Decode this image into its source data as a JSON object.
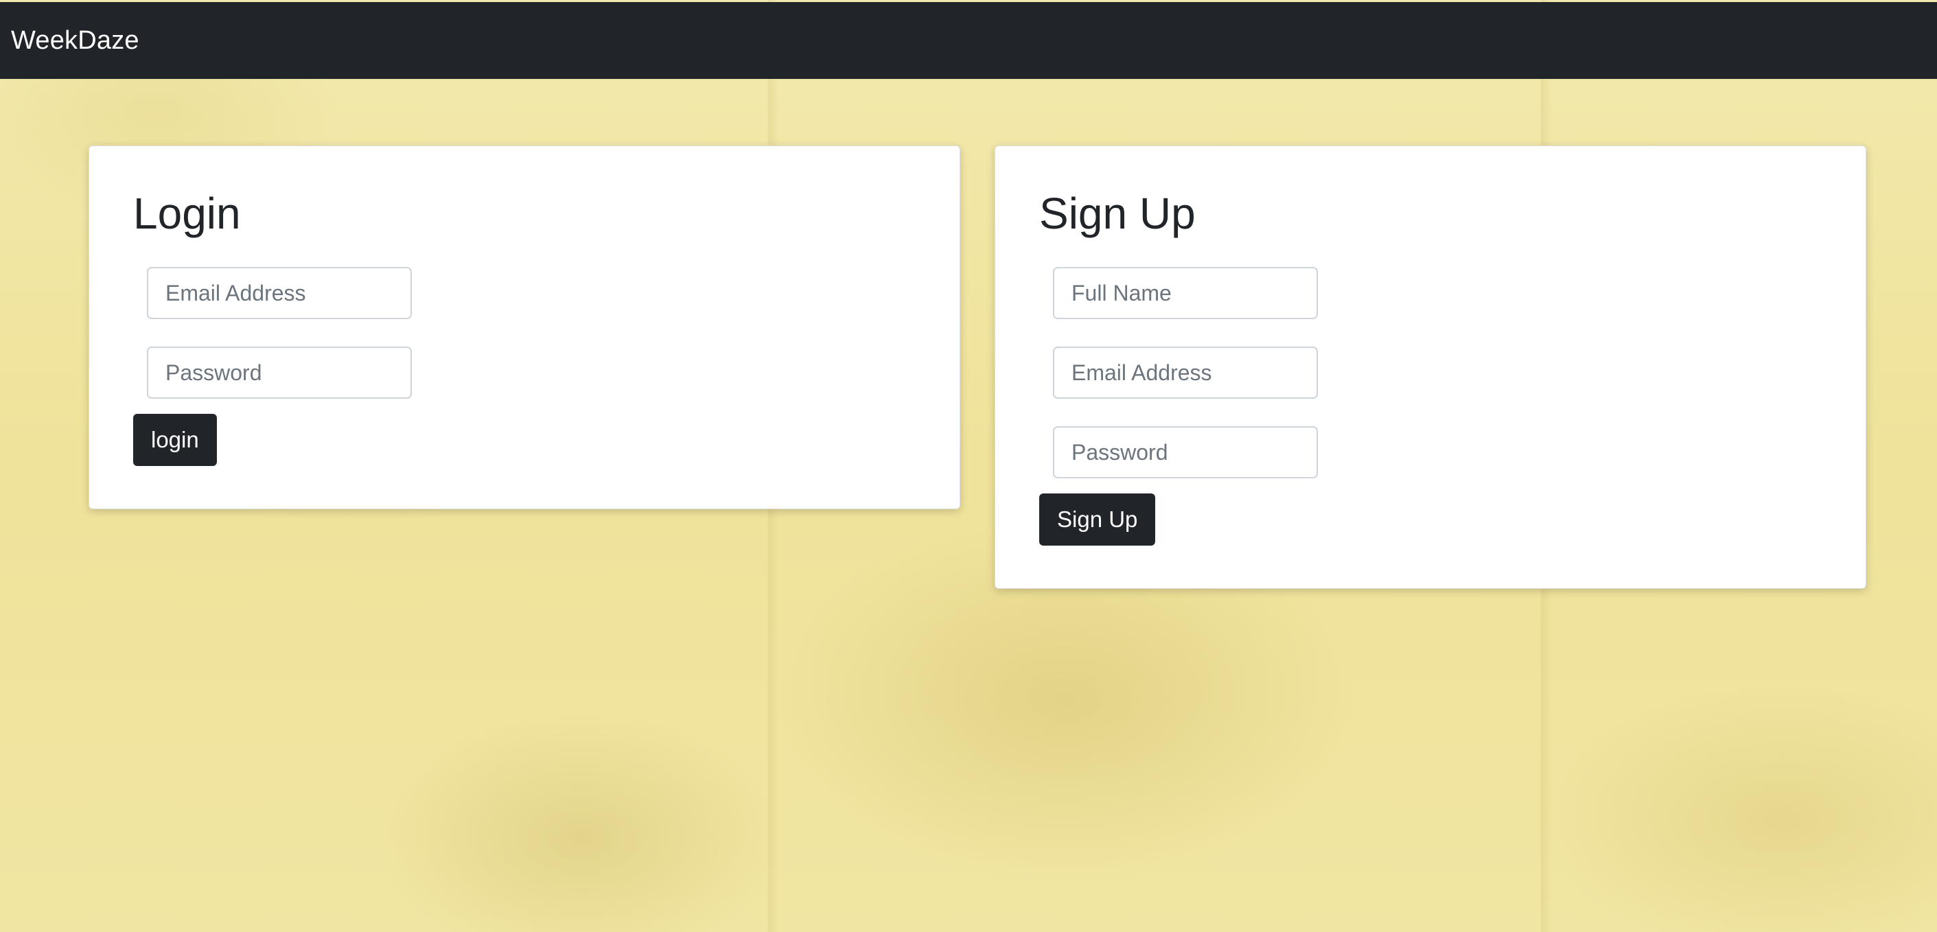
{
  "navbar": {
    "brand": "WeekDaze"
  },
  "login": {
    "title": "Login",
    "email_placeholder": "Email Address",
    "password_placeholder": "Password",
    "button_label": "login"
  },
  "signup": {
    "title": "Sign Up",
    "name_placeholder": "Full Name",
    "email_placeholder": "Email Address",
    "password_placeholder": "Password",
    "button_label": "Sign Up"
  },
  "colors": {
    "navbar_bg": "#212529",
    "button_bg": "#212529",
    "page_bg": "#f2e7a6"
  }
}
